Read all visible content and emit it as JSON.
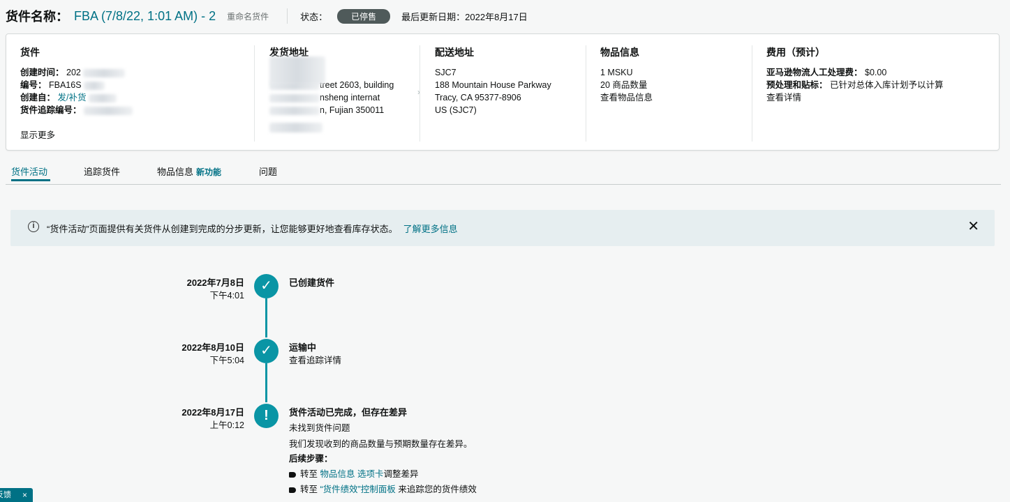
{
  "header": {
    "label": "货件名称：",
    "shipment_name": "FBA (7/8/22, 1:01 AM) - 2",
    "rename": "重命名货件",
    "status_label": "状态：",
    "status_badge": "已停售",
    "last_updated": "最后更新日期：2022年8月17日"
  },
  "summary": {
    "shipment": {
      "title": "货件",
      "created_label": "创建时间：",
      "created_value": "202",
      "id_label": "编号：",
      "id_value": "FBA16S",
      "creator_label": "创建自：",
      "creator_value": "发/补货",
      "tracking_label": "货件追踪编号：",
      "show_more": "显示更多"
    },
    "ship_from": {
      "title": "发货地址",
      "line1": "treet 2603, building",
      "line2": "nsheng internat",
      "line3": "n, Fujian 350011"
    },
    "ship_to": {
      "title": "配送地址",
      "lines": [
        "SJC7",
        "188 Mountain House Parkway",
        "Tracy, CA 95377-8906",
        "US (SJC7)"
      ]
    },
    "items": {
      "title": "物品信息",
      "msku": "1 MSKU",
      "units": "20 商品数量",
      "view": "查看物品信息"
    },
    "fees": {
      "title": "费用（预计）",
      "labor_label": "亚马逊物流人工处理费：",
      "labor_value": "$0.00",
      "prep_label": "预处理和贴标：",
      "prep_value": "已针对总体入库计划予以计算",
      "view": "查看详情"
    }
  },
  "tabs": {
    "activity": "货件活动",
    "tracking": "追踪货件",
    "items": "物品信息",
    "items_new": "新功能",
    "problems": "问题"
  },
  "banner": {
    "text": "“货件活动”页面提供有关货件从创建到完成的分步更新，让您能够更好地查看库存状态。",
    "link": "了解更多信息",
    "close": "✕"
  },
  "timeline": {
    "e1": {
      "date": "2022年7月8日",
      "time": "下午4:01",
      "title": "已创建货件"
    },
    "e2": {
      "date": "2022年8月10日",
      "time": "下午5:04",
      "title": "运输中",
      "link": "查看追踪详情"
    },
    "e3": {
      "date": "2022年8月17日",
      "time": "上午0:12",
      "title": "货件活动已完成，但存在差异",
      "issue": "未找到货件问题",
      "desc": "我们发现收到的商品数量与预期数量存在差异。",
      "next_label": "后续步骤：",
      "step1_pre": "转至",
      "step1_link": "物品信息 选项卡",
      "step1_post": "调整差异",
      "step2_pre": "转至",
      "step2_link": "“货件绩效”控制面板",
      "step2_post": "来追踪您的货件绩效"
    }
  },
  "feedback": {
    "label": "反馈",
    "close": "×"
  },
  "icons": {
    "check": "✓",
    "alert": "!",
    "info": "i",
    "chevron": "›"
  }
}
